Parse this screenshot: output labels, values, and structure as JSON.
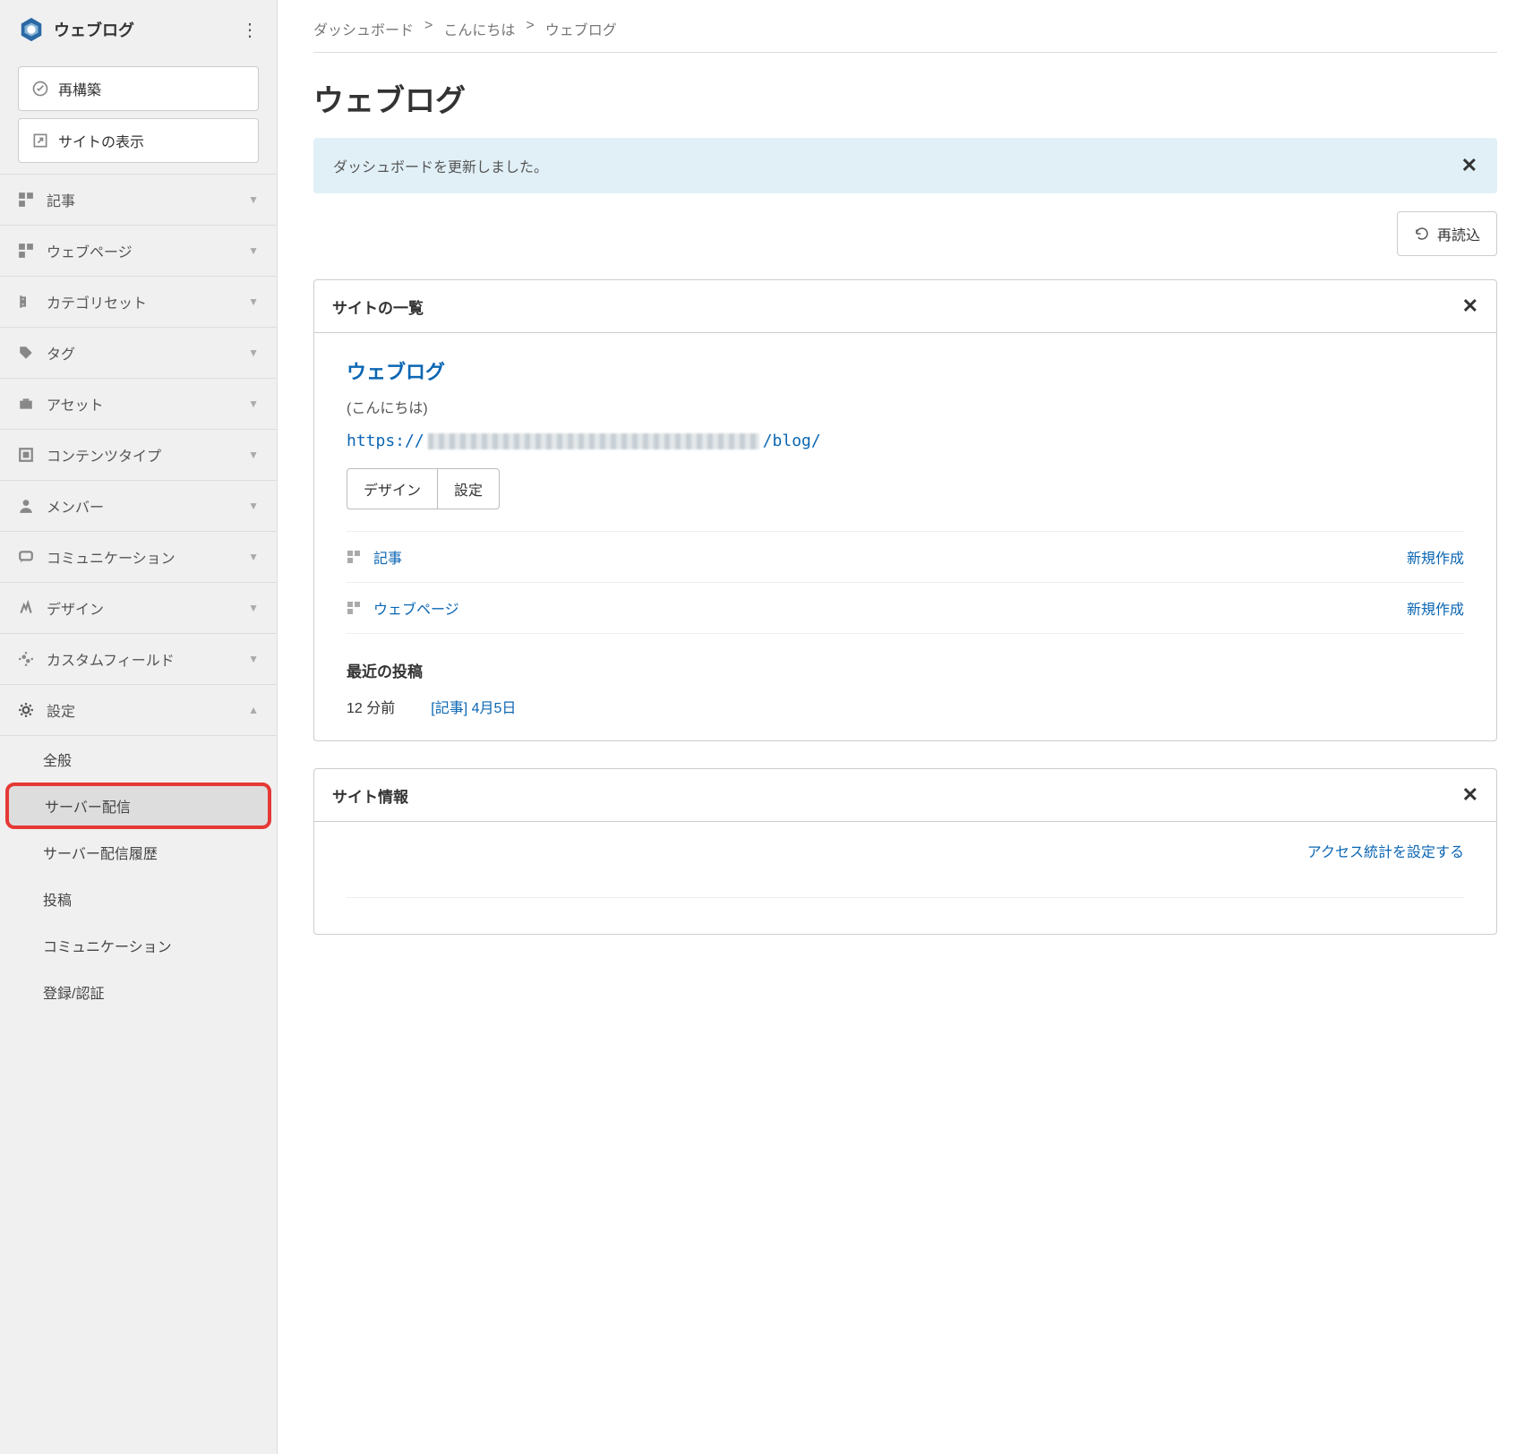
{
  "sidebar": {
    "site_title": "ウェブログ",
    "rebuild_button": "再構築",
    "view_site_button": "サイトの表示",
    "nav": [
      {
        "label": "記事",
        "icon": "entries-icon"
      },
      {
        "label": "ウェブページ",
        "icon": "pages-icon"
      },
      {
        "label": "カテゴリセット",
        "icon": "category-icon"
      },
      {
        "label": "タグ",
        "icon": "tag-icon"
      },
      {
        "label": "アセット",
        "icon": "asset-icon"
      },
      {
        "label": "コンテンツタイプ",
        "icon": "contenttype-icon"
      },
      {
        "label": "メンバー",
        "icon": "member-icon"
      },
      {
        "label": "コミュニケーション",
        "icon": "communication-icon"
      },
      {
        "label": "デザイン",
        "icon": "design-icon"
      },
      {
        "label": "カスタムフィールド",
        "icon": "customfield-icon"
      },
      {
        "label": "設定",
        "icon": "settings-icon",
        "expanded": true
      }
    ],
    "settings_sub": [
      "全般",
      "サーバー配信",
      "サーバー配信履歴",
      "投稿",
      "コミュニケーション",
      "登録/認証"
    ]
  },
  "breadcrumb": [
    "ダッシュボード",
    "こんにちは",
    "ウェブログ"
  ],
  "page_title": "ウェブログ",
  "alert": "ダッシュボードを更新しました。",
  "reload_button": "再読込",
  "site_list": {
    "title": "サイトの一覧",
    "site_name": "ウェブログ",
    "site_sub": "(こんにちは)",
    "url_prefix": "https://",
    "url_suffix": "/blog/",
    "design_button": "デザイン",
    "settings_button": "設定",
    "rows": [
      {
        "label": "記事",
        "action": "新規作成"
      },
      {
        "label": "ウェブページ",
        "action": "新規作成"
      }
    ],
    "recent_title": "最近の投稿",
    "recent_time": "12 分前",
    "recent_link": "[記事] 4月5日"
  },
  "site_info": {
    "title": "サイト情報",
    "stats_link": "アクセス統計を設定する"
  }
}
